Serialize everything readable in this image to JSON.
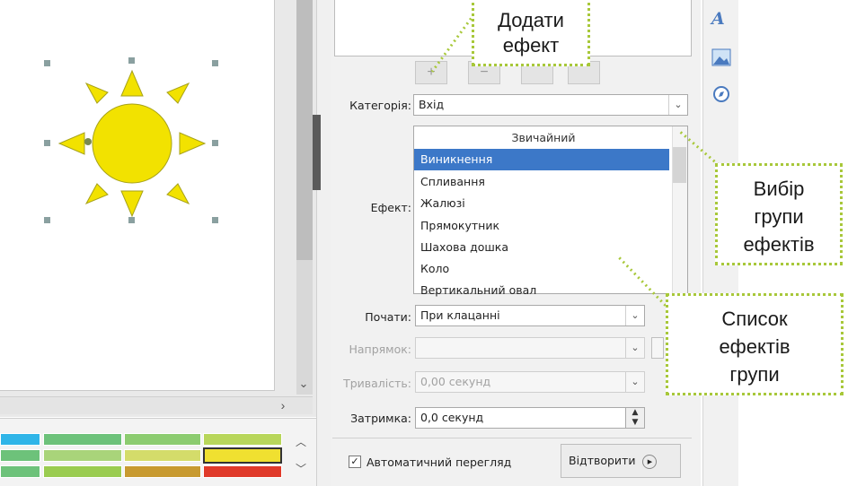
{
  "toolbar": {
    "add_effect_symbol": "+",
    "remove_effect_symbol": "−"
  },
  "category": {
    "label": "Категорія:",
    "value": "Вхід"
  },
  "effect": {
    "label": "Ефект:",
    "group_header": "Звичайний",
    "items": [
      "Виникнення",
      "Спливання",
      "Жалюзі",
      "Прямокутник",
      "Шахова дошка",
      "Коло",
      "Вертикальний овал"
    ],
    "selected": "Виникнення"
  },
  "start": {
    "label": "Почати:",
    "value": "При клацанні"
  },
  "direction": {
    "label": "Напрямок:",
    "value": ""
  },
  "duration": {
    "label": "Тривалість:",
    "value": "0,00 секунд"
  },
  "delay": {
    "label": "Затримка:",
    "value": "0,0 секунд"
  },
  "autopreview": {
    "label": "Автоматичний перегляд",
    "checked": true
  },
  "play_button": {
    "label": "Відтворити"
  },
  "callouts": {
    "add_effect": [
      "Додати",
      "ефект"
    ],
    "group_select": [
      "Вибір",
      "групи",
      "ефектів"
    ],
    "effects_list": [
      "Список",
      "ефектів",
      "групи"
    ]
  },
  "colors": {
    "selection": "#3c78c8",
    "sun": "#f2e200",
    "callout_border": "#a8c83a"
  },
  "palette_swatches": [
    "#2fb5e8",
    "#6dc27a",
    "#8ccc70",
    "#b8d65a",
    "#6dc27a",
    "#a9d47a",
    "#d4dc6a",
    "#f0e030",
    "#6dc27a",
    "#9acc50",
    "#c89a30",
    "#e03a2a"
  ],
  "icons": [
    "fontwork-icon",
    "image-icon",
    "navigator-icon",
    "checkbox-icon",
    "play-icon",
    "chevron-down-icon"
  ]
}
